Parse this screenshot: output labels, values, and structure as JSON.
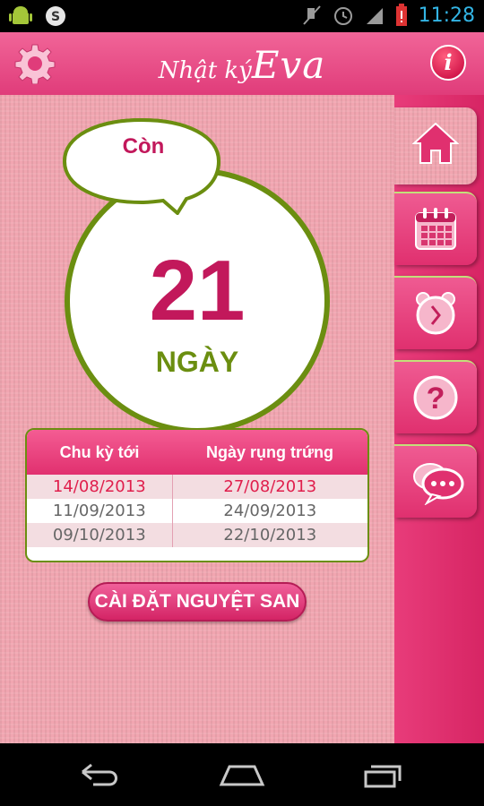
{
  "status_bar": {
    "time": "11:28",
    "icons": [
      "android-icon",
      "sync-icon",
      "mute-icon",
      "alarm-icon",
      "signal-icon",
      "battery-alert-icon"
    ]
  },
  "header": {
    "logo_text": "Nhật ký",
    "logo_script": "Eva",
    "settings_icon": "gear-icon",
    "info_label": "i"
  },
  "countdown": {
    "bubble_text": "Còn",
    "days": "21",
    "unit": "NGÀY"
  },
  "cycle_table": {
    "headers": [
      "Chu kỳ tới",
      "Ngày rụng trứng"
    ],
    "rows": [
      [
        "14/08/2013",
        "27/08/2013"
      ],
      [
        "11/09/2013",
        "24/09/2013"
      ],
      [
        "09/10/2013",
        "22/10/2013"
      ]
    ]
  },
  "setup_button": {
    "label": "CÀI ĐẶT NGUYỆT SAN"
  },
  "side_tabs": [
    {
      "icon": "home-icon",
      "active": true
    },
    {
      "icon": "calendar-icon",
      "active": false
    },
    {
      "icon": "alarm-clock-icon",
      "active": false
    },
    {
      "icon": "help-icon",
      "active": false
    },
    {
      "icon": "chat-icon",
      "active": false
    }
  ],
  "nav_bar": [
    "back-icon",
    "home-nav-icon",
    "recent-apps-icon"
  ],
  "colors": {
    "accent_pink": "#e0306f",
    "number_red": "#c2185b",
    "olive_green": "#6b8e10",
    "background_pink": "#f1a5b0"
  }
}
